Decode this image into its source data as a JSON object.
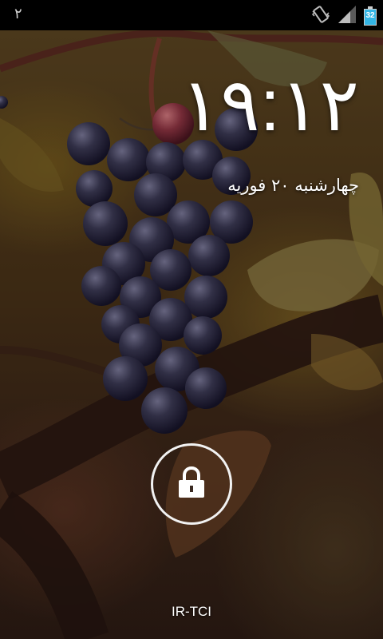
{
  "status_bar": {
    "notification_count": "٢",
    "icons": [
      "vibrate-icon",
      "signal-icon",
      "battery-icon"
    ],
    "battery_level": "32"
  },
  "lockscreen": {
    "time": "١٩:١٢",
    "date": "چهارشنبه ٢٠ فوریه",
    "carrier": "IR-TCI",
    "unlock_icon": "padlock-icon"
  },
  "colors": {
    "status_bar_bg": "#000000",
    "battery_fill": "#33b5e5",
    "text": "#ffffff"
  }
}
